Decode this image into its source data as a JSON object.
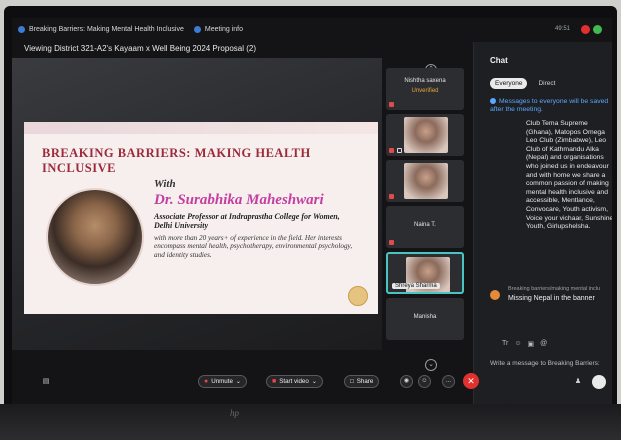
{
  "topbar": {
    "meeting_title": "Breaking Barriers: Making Mental Health Inclusive",
    "meeting_info": "Meeting info",
    "time": "49:51"
  },
  "stage": {
    "viewing": "Viewing District 321-A2's Kayaam x Well Being 2024 Proposal (2)"
  },
  "slide": {
    "title": "BREAKING BARRIERS: MAKING HEALTH INCLUSIVE",
    "with": "With",
    "speaker": "Dr. Surabhika Maheshwari",
    "role": "Associate Professor at Indraprastha College for Women, Delhi University",
    "bio": "with more than 20 years+ of experience in the field. Her interests encompass mental health, psychotherapy, environmental psychology, and identity studies."
  },
  "participants": [
    {
      "name": "Nishtha saxena",
      "status": "Unverified"
    },
    {
      "name": ""
    },
    {
      "name": ""
    },
    {
      "name": "Naina T."
    },
    {
      "name": "Shreya Sharma"
    },
    {
      "name": "Manisha"
    }
  ],
  "chat": {
    "heading": "Chat",
    "tab_everyone": "Everyone",
    "tab_direct": "Direct",
    "notice": "Messages to everyone will be saved after the meeting.",
    "message_body": "Club Tema Supreme (Ghana), Matopos Omega Leo Club (Zimbabwe), Leo Club of Kathmandu Alka (Nepal) and organisations who joined us in endeavour and with home we share a common passion of making mental health inclusive and accessible, Mentlance, Convocare, Youth activism, Voice your vichaar, Sunshine Youth, Girlupshelsha.",
    "sender2": "Breaking barriers/making mental inclu",
    "message2": "Missing Nepal in the banner",
    "compose_placeholder": "Write a message to Breaking Barriers:"
  },
  "controls": {
    "unmute": "Unmute",
    "start_video": "Start video",
    "share": "Share",
    "more": "..."
  },
  "colors": {
    "accent_blue": "#5aa7ff",
    "leave_red": "#e0312f",
    "speaker_magenta": "#c33ea0",
    "title_red": "#9b2a3a"
  }
}
